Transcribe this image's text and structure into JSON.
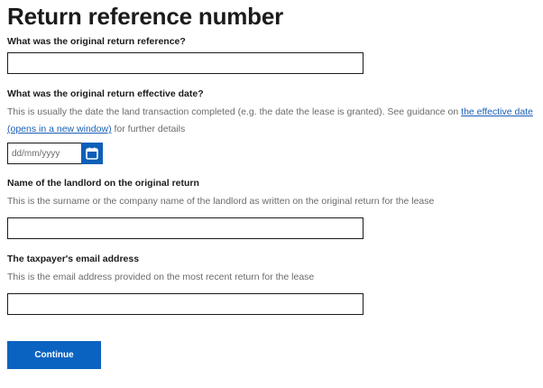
{
  "page": {
    "title": "Return reference number"
  },
  "fields": {
    "original_reference": {
      "label": "What was the original return reference?",
      "value": ""
    },
    "effective_date": {
      "label": "What was the original return effective date?",
      "hint_before": "This is usually the date the land transaction completed (e.g. the date the lease is granted). See guidance on ",
      "hint_link": "the effective date (opens in a new window)",
      "hint_after": " for further details",
      "placeholder": "dd/mm/yyyy",
      "calendar_icon": "calendar-icon"
    },
    "landlord_name": {
      "label": "Name of the landlord on the original return",
      "hint": "This is the surname or the company name of the landlord as written on the original return for the lease",
      "value": ""
    },
    "taxpayer_email": {
      "label": "The taxpayer's email address",
      "hint": "This is the email address provided on the most recent return for the lease",
      "value": ""
    }
  },
  "actions": {
    "continue_label": "Continue"
  },
  "colors": {
    "primary": "#0b63c1",
    "link": "#1a5fb4",
    "hint": "#6b6b6b"
  }
}
